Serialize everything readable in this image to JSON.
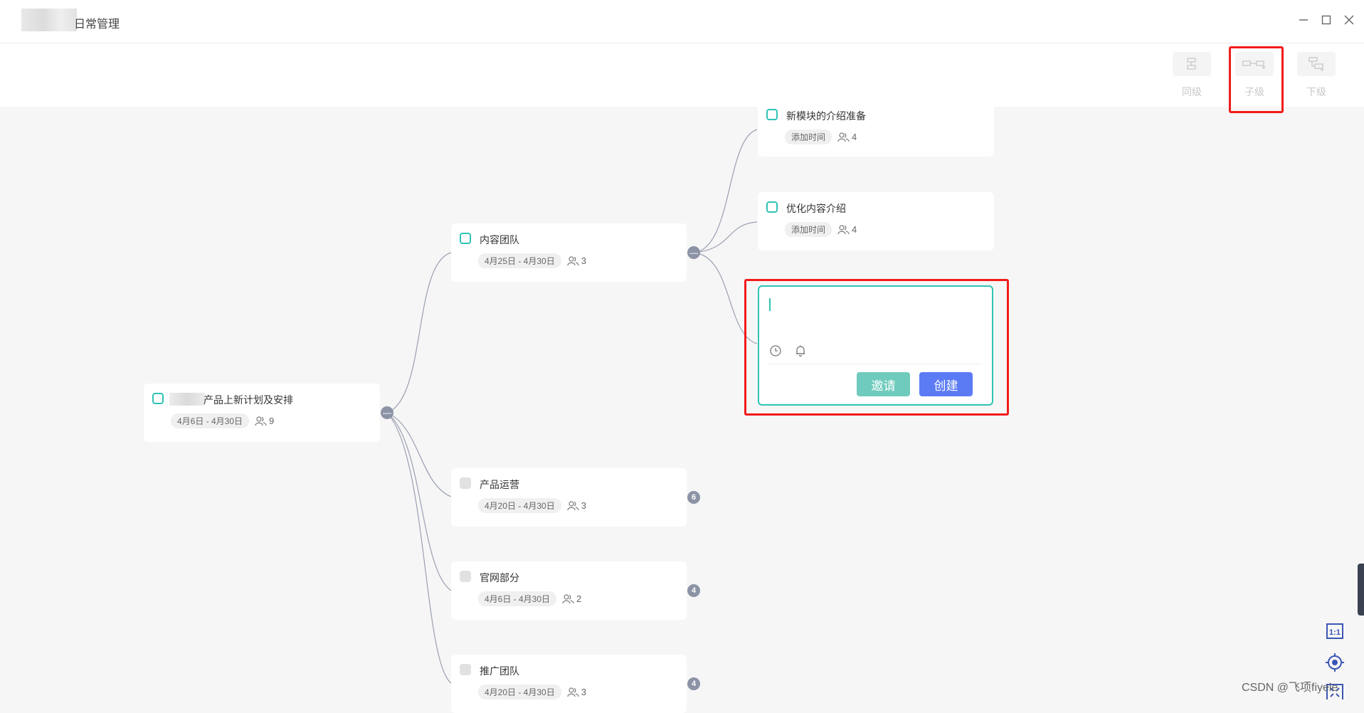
{
  "window": {
    "title": "日常管理",
    "controls": [
      "minimize",
      "maximize",
      "close"
    ]
  },
  "toolbar": {
    "buttons": [
      {
        "label": "同级",
        "icon": "sibling-node-icon"
      },
      {
        "label": "子级",
        "icon": "child-node-icon"
      },
      {
        "label": "下级",
        "icon": "subordinate-node-icon"
      }
    ]
  },
  "mindmap": {
    "root": {
      "title": "产品上新计划及安排",
      "date": "4月6日 - 4月30日",
      "members": "9"
    },
    "branches": [
      {
        "title": "内容团队",
        "date": "4月25日 - 4月30日",
        "members": "3"
      },
      {
        "title": "产品运营",
        "date": "4月20日 - 4月30日",
        "members": "3",
        "children_count": "6"
      },
      {
        "title": "官网部分",
        "date": "4月6日 - 4月30日",
        "members": "2",
        "children_count": "4"
      },
      {
        "title": "推广团队",
        "date": "4月20日 - 4月30日",
        "members": "3",
        "children_count": "4"
      }
    ],
    "subtasks": [
      {
        "title": "新模块的介绍准备",
        "date": "添加时间",
        "members": "4"
      },
      {
        "title": "优化内容介绍",
        "date": "添加时间",
        "members": "4"
      }
    ]
  },
  "editor": {
    "value": "",
    "invite_label": "邀请",
    "create_label": "创建"
  },
  "watermark": "CSDN @飞项fiyele",
  "colors": {
    "accent": "#2ec4b6",
    "primary": "#5b7bf5",
    "highlight": "#f21b1b",
    "connector": "#9aa0b1"
  }
}
